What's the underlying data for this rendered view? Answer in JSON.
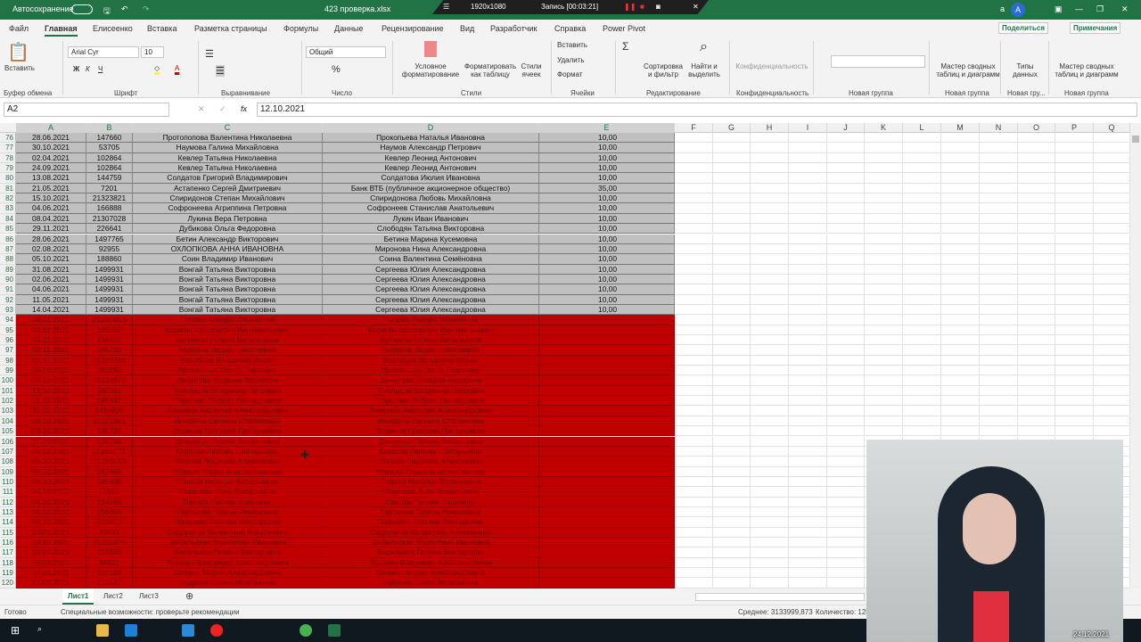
{
  "titlebar": {
    "autosave": "Автосохранение",
    "filename": "423 проверка.xlsx",
    "user_initial": "а",
    "avatar": "A"
  },
  "recorder": {
    "resolution": "1920x1080",
    "status": "Запись [00:03:21]"
  },
  "menu": [
    "Файл",
    "Главная",
    "Елисеенко",
    "Вставка",
    "Разметка страницы",
    "Формулы",
    "Данные",
    "Рецензирование",
    "Вид",
    "Разработчик",
    "Справка",
    "Power Pivot"
  ],
  "share": "Поделиться",
  "comments": "Примечания",
  "ribbon": {
    "paste": "Вставить",
    "font_name": "Arial Cyr",
    "font_size": "10",
    "number_format": "Общий",
    "cond_format": "Условное форматирование",
    "format_table": "Форматировать как таблицу",
    "cell_styles": "Стили ячеек",
    "insert": "Вставить",
    "delete": "Удалить",
    "format": "Формат",
    "sort": "Сортировка и фильтр",
    "find": "Найти и выделить",
    "confidential": "Конфиденциальность",
    "pivot1": "Мастер сводных таблиц и диаграмм",
    "data_types": "Типы данных",
    "pivot2": "Мастер сводных таблиц и диаграмм",
    "groups": [
      "Буфер обмена",
      "Шрифт",
      "Выравнивание",
      "Число",
      "Стили",
      "Ячейки",
      "Редактирование",
      "Конфиденциальность",
      "Новая группа",
      "Новая группа",
      "Новая гру...",
      "Новая группа"
    ]
  },
  "formula_bar": {
    "name_box": "A2",
    "formula": "12.10.2021",
    "fx": "fx"
  },
  "columns": [
    "A",
    "B",
    "C",
    "D",
    "E",
    "F",
    "G",
    "H",
    "I",
    "J",
    "K",
    "L",
    "M",
    "N",
    "O",
    "P",
    "Q"
  ],
  "rows": [
    [
      "76",
      "28.06.2021",
      "147660",
      "Протопопова Валентина Николаевна",
      "Прокопьева Наталья Ивановна",
      "10,00"
    ],
    [
      "77",
      "30.10.2021",
      "53705",
      "Наумова Галина Михайловна",
      "Наумов Александр Петрович",
      "10,00"
    ],
    [
      "78",
      "02.04.2021",
      "102864",
      "Кевлер Татьяна Николаевна",
      "Кевлер Леонид Антонович",
      "10,00"
    ],
    [
      "79",
      "24.09.2021",
      "102864",
      "Кевлер Татьяна Николаевна",
      "Кевлер Леонид Антонович",
      "10,00"
    ],
    [
      "80",
      "13.08.2021",
      "144759",
      "Солдатов Григорий Владимирович",
      "Солдатова Июлия Ивановна",
      "10,00"
    ],
    [
      "81",
      "21.05.2021",
      "7201",
      "Астапенко Сергей Дмитриевич",
      "Банк ВТБ (публичное акционерное общество)",
      "35,00"
    ],
    [
      "82",
      "15.10.2021",
      "21323821",
      "Спиридонов Степан Михайлович",
      "Спиридонова Любовь Михайловна",
      "10,00"
    ],
    [
      "83",
      "04.06.2021",
      "166888",
      "Софронеева Агриппина Петровна",
      "Софронеев Станислав Анатольевич",
      "10,00"
    ],
    [
      "84",
      "08.04.2021",
      "21307028",
      "Лукина Вера Петровна",
      "Лукин Иван Иванович",
      "10,00"
    ],
    [
      "85",
      "29.11.2021",
      "226641",
      "Дубикова Ольга Федоровна",
      "Слободян Татьяна Викторовна",
      "10,00"
    ],
    [
      "86",
      "28.06.2021",
      "1497765",
      "Бетин Александр Викторович",
      "Бетина Марина Кусемовна",
      "10,00"
    ],
    [
      "87",
      "02.08.2021",
      "92955",
      "ОХЛОПКОВА АННА ИВАНОВНА",
      "Миронова Нина Александровна",
      "10,00"
    ],
    [
      "88",
      "05.10.2021",
      "188860",
      "Соин Владимир Иванович",
      "Соина Валентина Семёновна",
      "10,00"
    ],
    [
      "89",
      "31.08.2021",
      "1499931",
      "Вонгай Татьяна Викторовна",
      "Сергеева Юлия Александровна",
      "10,00"
    ],
    [
      "90",
      "02.06.2021",
      "1499931",
      "Вонгай Татьяна Викторовна",
      "Сергеева Юлия Александровна",
      "10,00"
    ],
    [
      "91",
      "04.06.2021",
      "1499931",
      "Вонгай Татьяна Викторовна",
      "Сергеева Юлия Александровна",
      "10,00"
    ],
    [
      "92",
      "11.05.2021",
      "1499931",
      "Вонгай Татьяна Викторовна",
      "Сергеева Юлия Александровна",
      "10,00"
    ],
    [
      "93",
      "14.04.2021",
      "1499931",
      "Вонгай Татьяна Викторовна",
      "Сергеева Юлия Александровна",
      "10,00"
    ],
    [
      "94",
      "08.11.2021",
      "21240608",
      "Попова Тамара Ильинична",
      "Попова Тамара Ильинична",
      ""
    ],
    [
      "95",
      "03.11.2021",
      "185652",
      "Корягин Константин Иннокентьевич",
      "Корягин Константин Иннокентьевич",
      ""
    ],
    [
      "96",
      "02.11.2021",
      "156910",
      "Бугреева Галина Витальевна",
      "Бугреева Галина Витальевна",
      ""
    ],
    [
      "97",
      "02.11.2021",
      "160739",
      "Анахина Лидия Николаевна",
      "Анахина Лидия Николаевна",
      ""
    ],
    [
      "98",
      "01.11.2021",
      "21346246",
      "Воробьев Владимир Ильич",
      "Воробьев Владимир Ильич",
      ""
    ],
    [
      "99",
      "29.10.2021",
      "261762",
      "Провальчук Ольга Павловна",
      "Провальчук Ольга Павловна",
      ""
    ],
    [
      "100",
      "28.10.2021",
      "21313973",
      "Данилова Клавдия Ивановна",
      "Данилова Клавдия Ивановна",
      ""
    ],
    [
      "101",
      "12.10.2021",
      "183091",
      "Хмельцов Владимир Петрович",
      "Хмельцов Владимир Петрович",
      ""
    ],
    [
      "102",
      "11.10.2021",
      "185347",
      "Паршина Любовь Геннадьевна",
      "Паршина Любовь Геннадьевна",
      ""
    ],
    [
      "103",
      "11.10.2021",
      "1499920",
      "Лимонов Анатолий Александрович",
      "Лимонов Анатолий Александрович",
      ""
    ],
    [
      "104",
      "08.10.2021",
      "21321981",
      "Инишина Евгения Степановна",
      "Инишина Евгения Степановна",
      ""
    ],
    [
      "105",
      "08.10.2021",
      "180724",
      "Борисов Григорий Григорьевич",
      "Борисов Григорий Григорьевич",
      ""
    ],
    [
      "106",
      "07.10.2021",
      "158744",
      "Деменчук Галина Васильевна",
      "Деменчук Галина Васильевна",
      ""
    ],
    [
      "107",
      "06.10.2021",
      "21265171",
      "Карпова Любовь Григорьевна",
      "Карпова Любовь Григорьевна",
      ""
    ],
    [
      "108",
      "05.10.2021",
      "21290153",
      "Попова Людмила Алексеевна",
      "Попова Людмила Алексеевна",
      ""
    ],
    [
      "109",
      "05.10.2021",
      "161665",
      "Улизько Лидия Константиновна",
      "Улизько Лидия Константиновна",
      ""
    ],
    [
      "110",
      "04.10.2021",
      "185836",
      "Попова Наталья Васильевна",
      "Попова Наталья Васильевна",
      ""
    ],
    [
      "111",
      "04.10.2021",
      "11541",
      "Юшинова Анна Васильевна",
      "Юшинова Анна Васильевна",
      ""
    ],
    [
      "112",
      "04.10.2021",
      "234466",
      "Панова Галина Ивановна",
      "Панова Галина Ивановна",
      ""
    ],
    [
      "113",
      "04.10.2021",
      "156659",
      "Тартыева Галина Романовна",
      "Тартыева Галина Романовна",
      ""
    ],
    [
      "114",
      "04.10.2021",
      "215412",
      "Лазарева Татьяна Викторовна",
      "Лазарева Татьяна Викторовна",
      ""
    ],
    [
      "115",
      "29.09.2021",
      "93541",
      "Сидоркина Валентина Алексеевна",
      "Сидоркина Валентина Алексеевна",
      ""
    ],
    [
      "116",
      "29.09.2021",
      "21281676",
      "Щебельская Валентина Ивановна",
      "Щебельская Валентина Ивановна",
      ""
    ],
    [
      "117",
      "28.09.2021",
      "210326",
      "Васильева Галина Викторовна",
      "Васильева Галина Викторовна",
      ""
    ],
    [
      "118",
      "28.09.2021",
      "84921",
      "Луканин Владимир Александрович",
      "Луканин Владимир Александрович",
      ""
    ],
    [
      "119",
      "27.09.2021",
      "102624",
      "Шевель Мария Александровна",
      "Шевель Мария Александровна",
      ""
    ],
    [
      "120",
      "27.09.2021",
      "212637",
      "Кудрина Елена Игнатьевна",
      "Кудрина Елена Игнатьевна",
      ""
    ]
  ],
  "gray_rows_until": "93",
  "sheets": [
    "Лист1",
    "Лист2",
    "Лист3"
  ],
  "status": {
    "ready": "Готово",
    "accessibility": "Специальные возможности: проверьте рекомендации",
    "average": "Среднее: 3133999,873",
    "count": "Количество: 128"
  },
  "taskbar": {
    "date": "24.12.2021"
  },
  "colors": {
    "excel_green": "#217346",
    "highlight_red": "#c00000",
    "highlight_gray": "#c0c0c0"
  }
}
